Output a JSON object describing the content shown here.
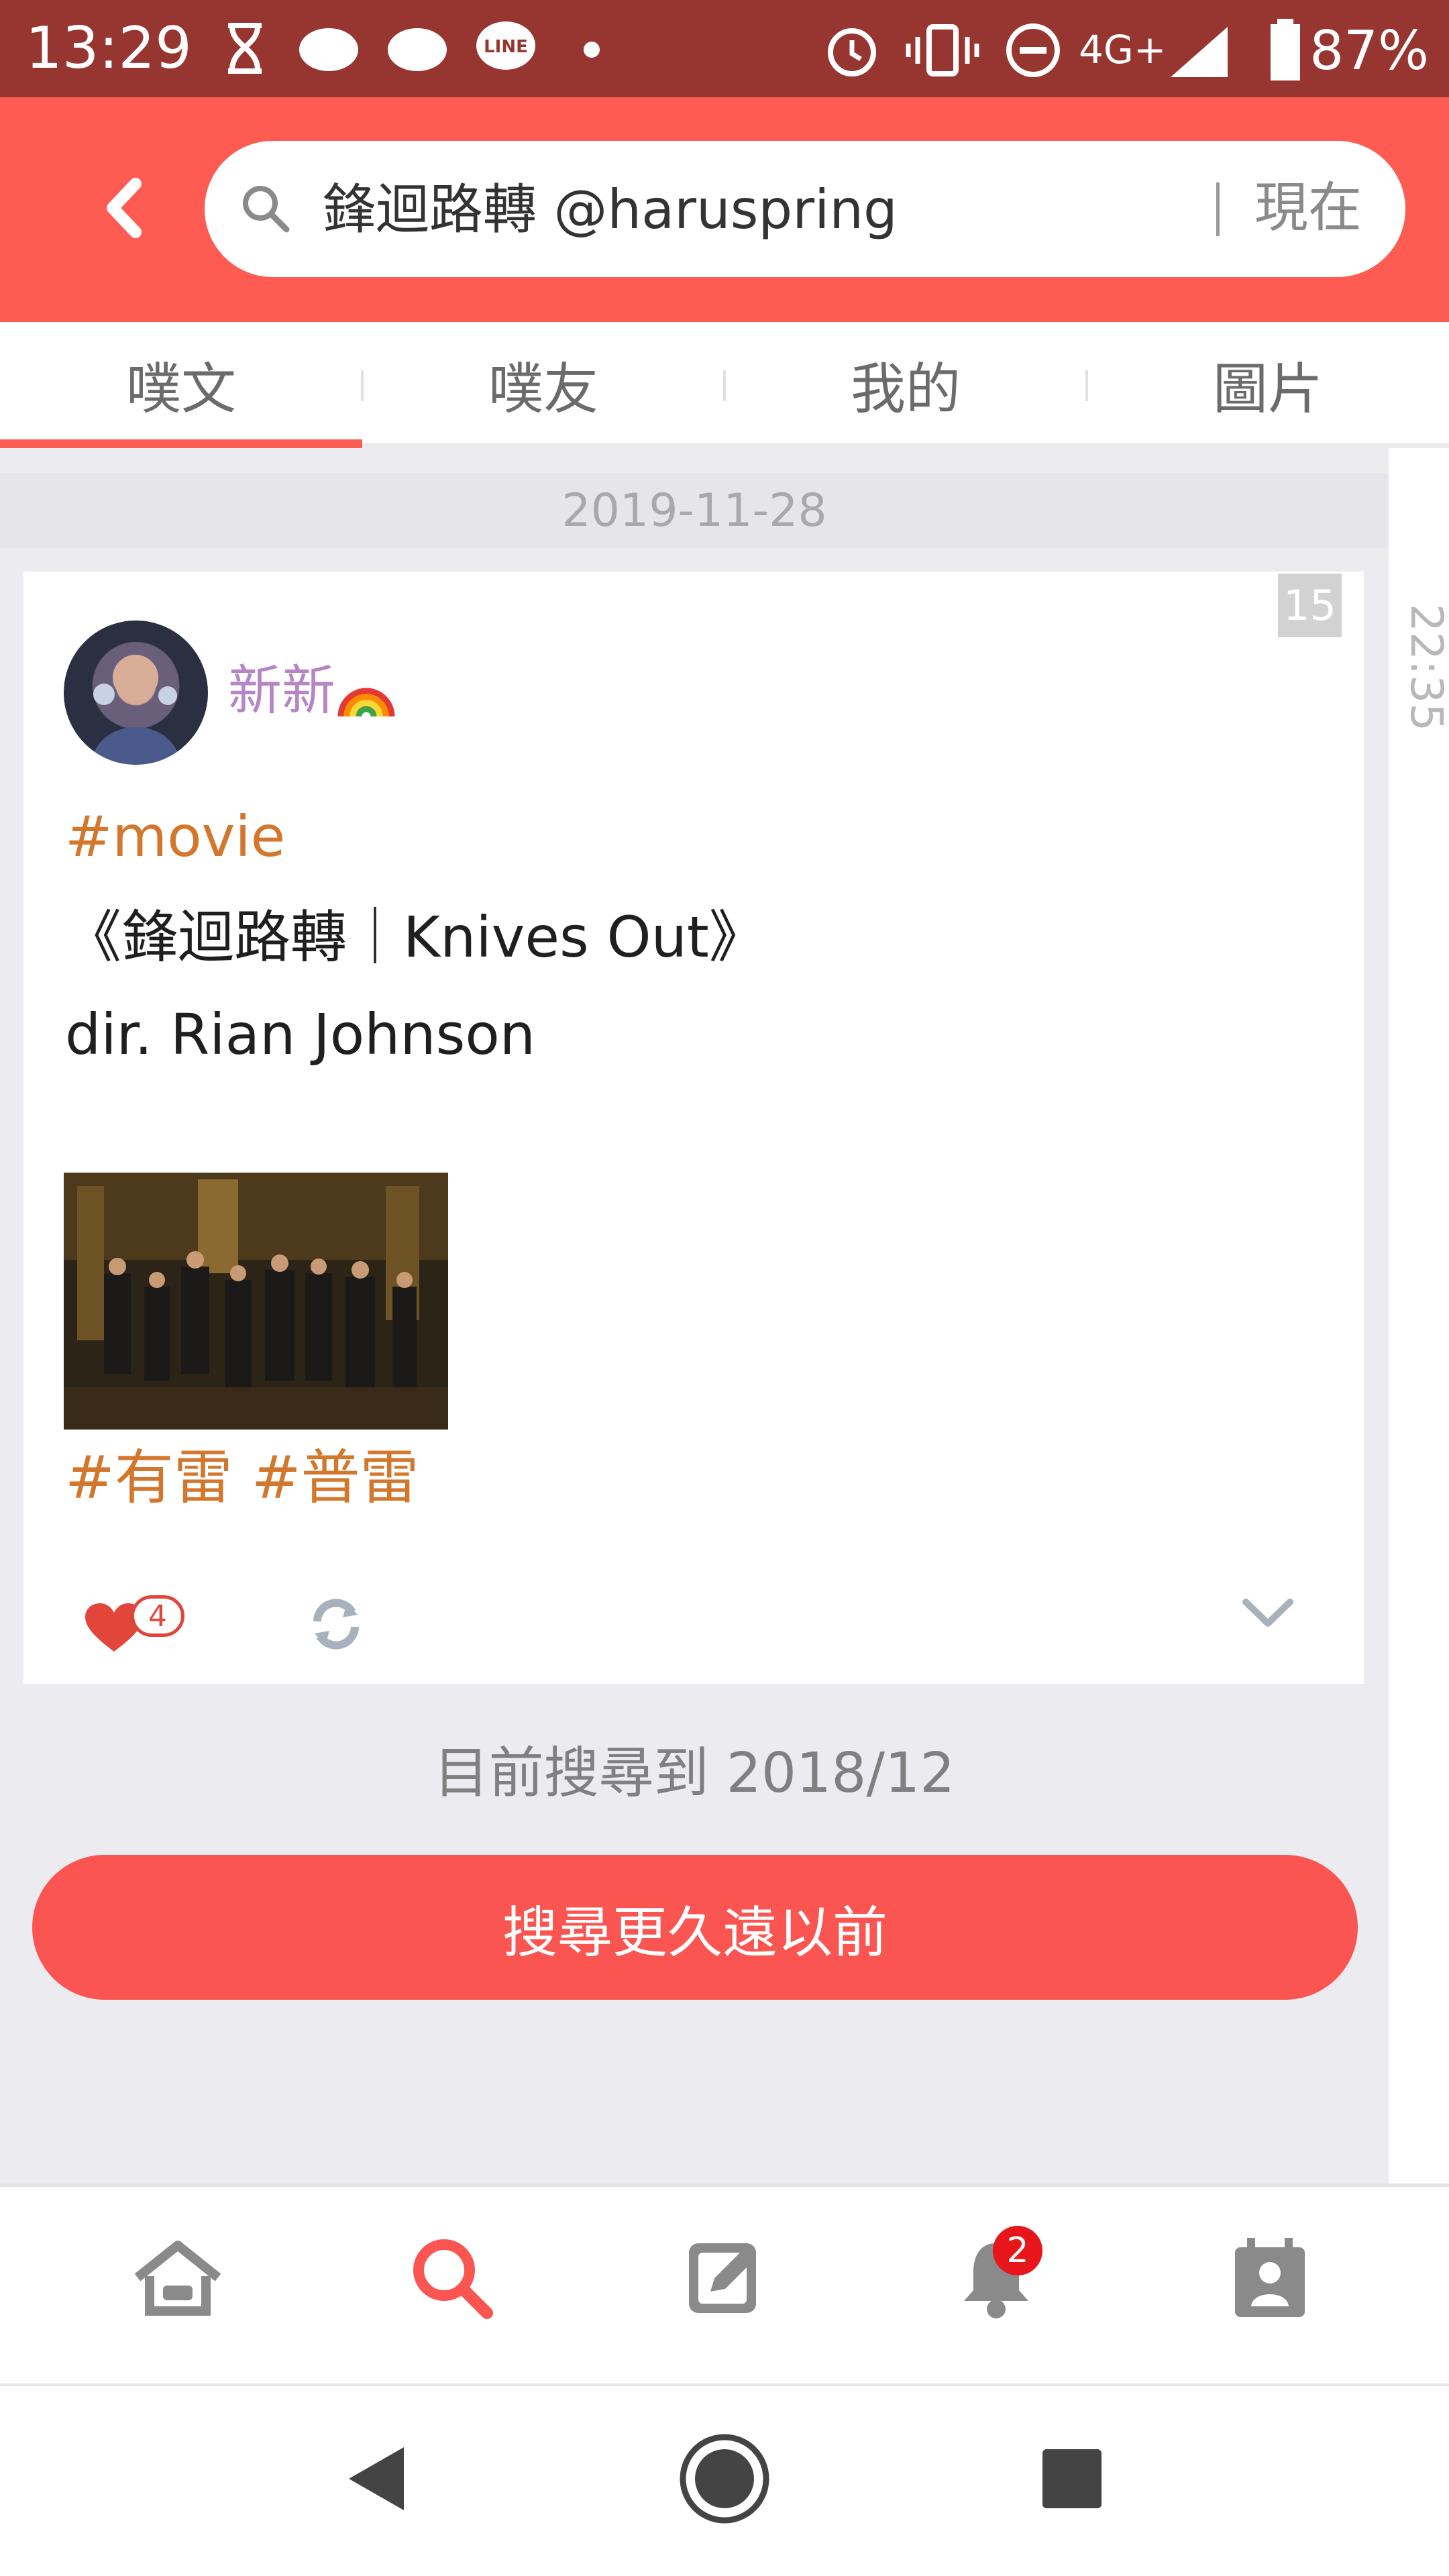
{
  "status_bar": {
    "time": "13:29",
    "network": "4G+",
    "battery": "87%"
  },
  "header": {
    "search_query": "鋒迴路轉 @haruspring",
    "search_range": "現在"
  },
  "tabs": [
    {
      "label": "噗文",
      "active": true
    },
    {
      "label": "噗友",
      "active": false
    },
    {
      "label": "我的",
      "active": false
    },
    {
      "label": "圖片",
      "active": false
    }
  ],
  "date_label": "2019-11-28",
  "post": {
    "count_badge": "15",
    "time": "22:35",
    "author": "新新",
    "hashtag": "#movie",
    "line1": "《鋒迴路轉｜Knives Out》",
    "line2": "dir. Rian Johnson",
    "tags": "#有雷 #普雷",
    "likes": "4"
  },
  "search_progress": "目前搜尋到 2018/12",
  "search_older_label": "搜尋更久遠以前",
  "bottom_nav": {
    "notification_count": "2"
  },
  "colors": {
    "brand": "#fe5b53",
    "status_bar": "#973630",
    "hashtag": "#d3772d",
    "author": "#b585c4"
  },
  "icons": [
    "back-icon",
    "search-icon",
    "heart-icon",
    "replurk-icon",
    "chevron-down-icon",
    "home-icon",
    "search-nav-icon",
    "compose-icon",
    "bell-icon",
    "profile-icon",
    "back-triangle-icon",
    "home-circle-icon",
    "recents-square-icon"
  ]
}
